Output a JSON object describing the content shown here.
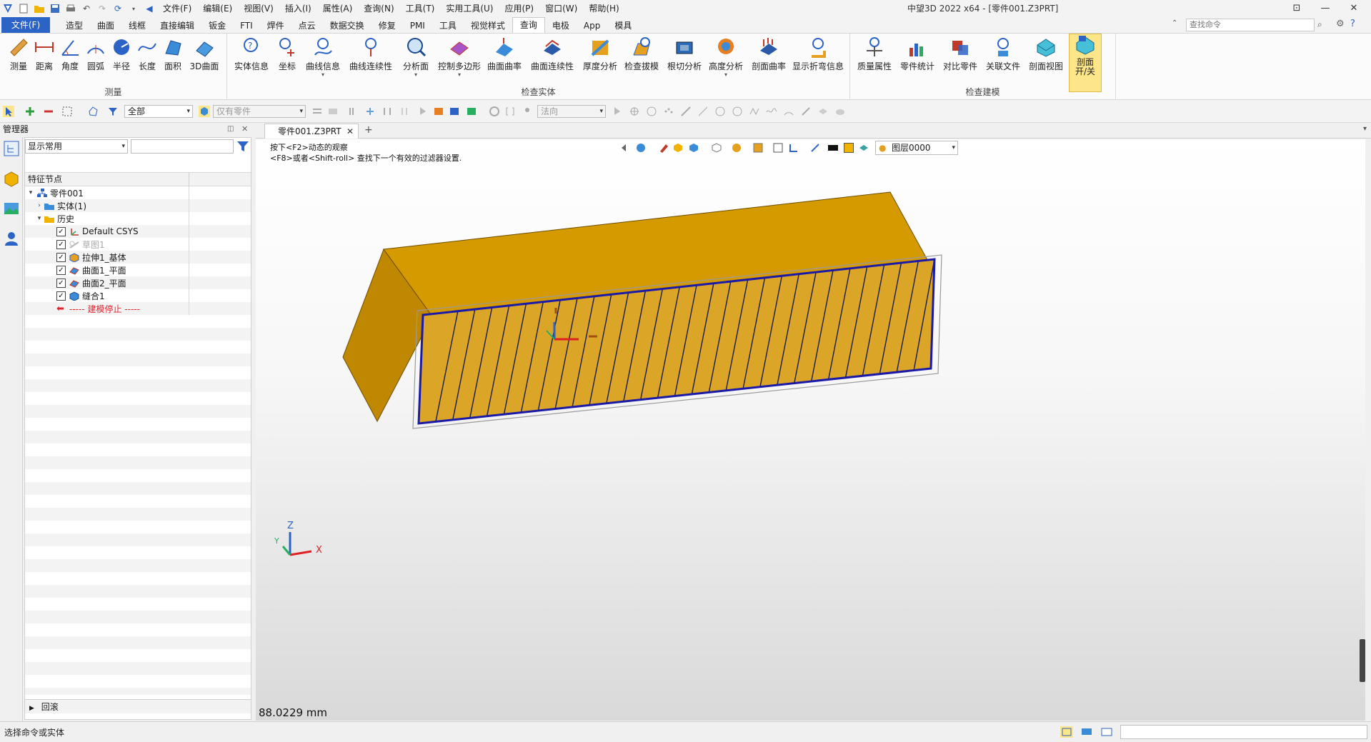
{
  "menu": {
    "items": [
      "文件(F)",
      "编辑(E)",
      "视图(V)",
      "插入(I)",
      "属性(A)",
      "查询(N)",
      "工具(T)",
      "实用工具(U)",
      "应用(P)",
      "窗口(W)",
      "帮助(H)"
    ]
  },
  "window": {
    "title": "中望3D 2022 x64 - [零件001.Z3PRT]"
  },
  "ribbon_tabs": {
    "file": "文件(F)",
    "tabs": [
      "造型",
      "曲面",
      "线框",
      "直接编辑",
      "钣金",
      "FTI",
      "焊件",
      "点云",
      "数据交换",
      "修复",
      "PMI",
      "工具",
      "视觉样式",
      "查询",
      "电极",
      "App",
      "模具"
    ],
    "active": "查询",
    "search_placeholder": "查找命令"
  },
  "ribbon": {
    "groups": [
      {
        "label": "测量",
        "buttons": [
          "测量",
          "距离",
          "角度",
          "圆弧",
          "半径",
          "长度",
          "面积",
          "3D曲面"
        ]
      },
      {
        "label": "检查实体",
        "buttons": [
          "实体信息",
          "坐标",
          "曲线信息",
          "曲线连续性",
          "分析面",
          "控制多边形",
          "曲面曲率",
          "曲面连续性",
          "厚度分析",
          "检查拔模",
          "根切分析",
          "高度分析",
          "剖面曲率",
          "显示折弯信息"
        ]
      },
      {
        "label": "检查建模",
        "buttons": [
          "质量属性",
          "零件统计",
          "对比零件",
          "关联文件",
          "剖面视图",
          "剖面 开/关"
        ]
      }
    ]
  },
  "toolbar": {
    "filter_value": "全部",
    "scope_value": "仅有零件",
    "direction_value": "法向"
  },
  "manager": {
    "title": "管理器",
    "filter_select": "显示常用",
    "tree_header": "特征节点",
    "nodes": [
      {
        "label": "零件001",
        "kind": "root",
        "expand": "▾"
      },
      {
        "label": "实体(1)",
        "kind": "folder",
        "expand": "›"
      },
      {
        "label": "历史",
        "kind": "folder",
        "expand": "▾"
      },
      {
        "label": "Default CSYS",
        "kind": "csys",
        "checked": true
      },
      {
        "label": "草图1",
        "kind": "sketch",
        "checked": true,
        "dim": true
      },
      {
        "label": "拉伸1_基体",
        "kind": "feature",
        "checked": true
      },
      {
        "label": "曲面1_平面",
        "kind": "feature",
        "checked": true
      },
      {
        "label": "曲面2_平面",
        "kind": "feature",
        "checked": true
      },
      {
        "label": "缝合1",
        "kind": "feature",
        "checked": true
      },
      {
        "label": "----- 建模停止 -----",
        "kind": "stop"
      }
    ],
    "rollback": "回滚"
  },
  "document": {
    "tab_label": "零件001.Z3PRT",
    "hint_line1": "按下<F2>动态的观察",
    "hint_line2": "<F8>或者<Shift-roll> 查找下一个有效的过滤器设置.",
    "layer": "图层0000",
    "distance": "88.0229 mm",
    "axis_labels": {
      "x": "X",
      "y": "Y",
      "z": "Z"
    }
  },
  "status": {
    "text": "选择命令或实体"
  },
  "colors": {
    "accent": "#2b63c6",
    "model_top": "#d59a00",
    "model_side": "#c08800",
    "model_front": "#dba528",
    "edge_blue": "#1a1aa8",
    "active_button": "#fde58a"
  }
}
